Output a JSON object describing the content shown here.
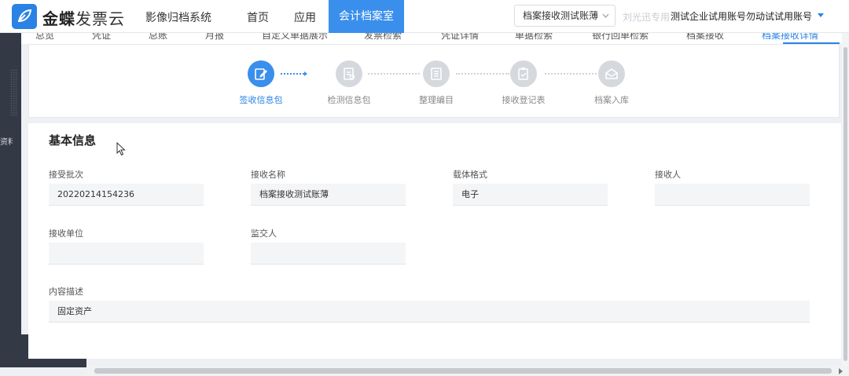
{
  "header": {
    "brand_strong": "金蝶",
    "brand_light": "发票云",
    "system_name": "影像归档系统",
    "nav_items": [
      {
        "label": "首页"
      },
      {
        "label": "应用"
      }
    ],
    "active_nav": "会计档案室",
    "close_glyph": "×",
    "ledger_select": "档案接收测试账薄",
    "user_faded": "刘光迅专用",
    "company": "测试企业试用账号勿动试试用账号"
  },
  "sidebar": {
    "label": "资料"
  },
  "subtabs": [
    {
      "label": "总览"
    },
    {
      "label": "凭证"
    },
    {
      "label": "总账"
    },
    {
      "label": "月报"
    },
    {
      "label": "自定义单据展示"
    },
    {
      "label": "发票检索"
    },
    {
      "label": "凭证详情"
    },
    {
      "label": "单据检索"
    },
    {
      "label": "银行回单检索"
    },
    {
      "label": "档案接收"
    },
    {
      "label": "档案接收详情"
    }
  ],
  "steps": [
    {
      "label": "签收信息包",
      "icon": "sign-icon",
      "active": true
    },
    {
      "label": "检测信息包",
      "icon": "inspect-icon",
      "active": false
    },
    {
      "label": "整理编目",
      "icon": "catalog-icon",
      "active": false
    },
    {
      "label": "接收登记表",
      "icon": "register-icon",
      "active": false
    },
    {
      "label": "档案入库",
      "icon": "storage-icon",
      "active": false
    }
  ],
  "basic_info": {
    "title": "基本信息",
    "fields": {
      "batch": {
        "label": "接受批次",
        "value": "20220214154236"
      },
      "name": {
        "label": "接收名称",
        "value": "档案接收测试账薄"
      },
      "format": {
        "label": "载体格式",
        "value": "电子"
      },
      "receiver": {
        "label": "接收人",
        "value": ""
      },
      "unit": {
        "label": "接收单位",
        "value": ""
      },
      "supervisor": {
        "label": "监交人",
        "value": ""
      },
      "description": {
        "label": "内容描述",
        "value": "固定资产"
      }
    }
  },
  "colors": {
    "accent": "#3a8fec",
    "sidebar": "#333945",
    "inactive_step": "#d5d8dd"
  }
}
